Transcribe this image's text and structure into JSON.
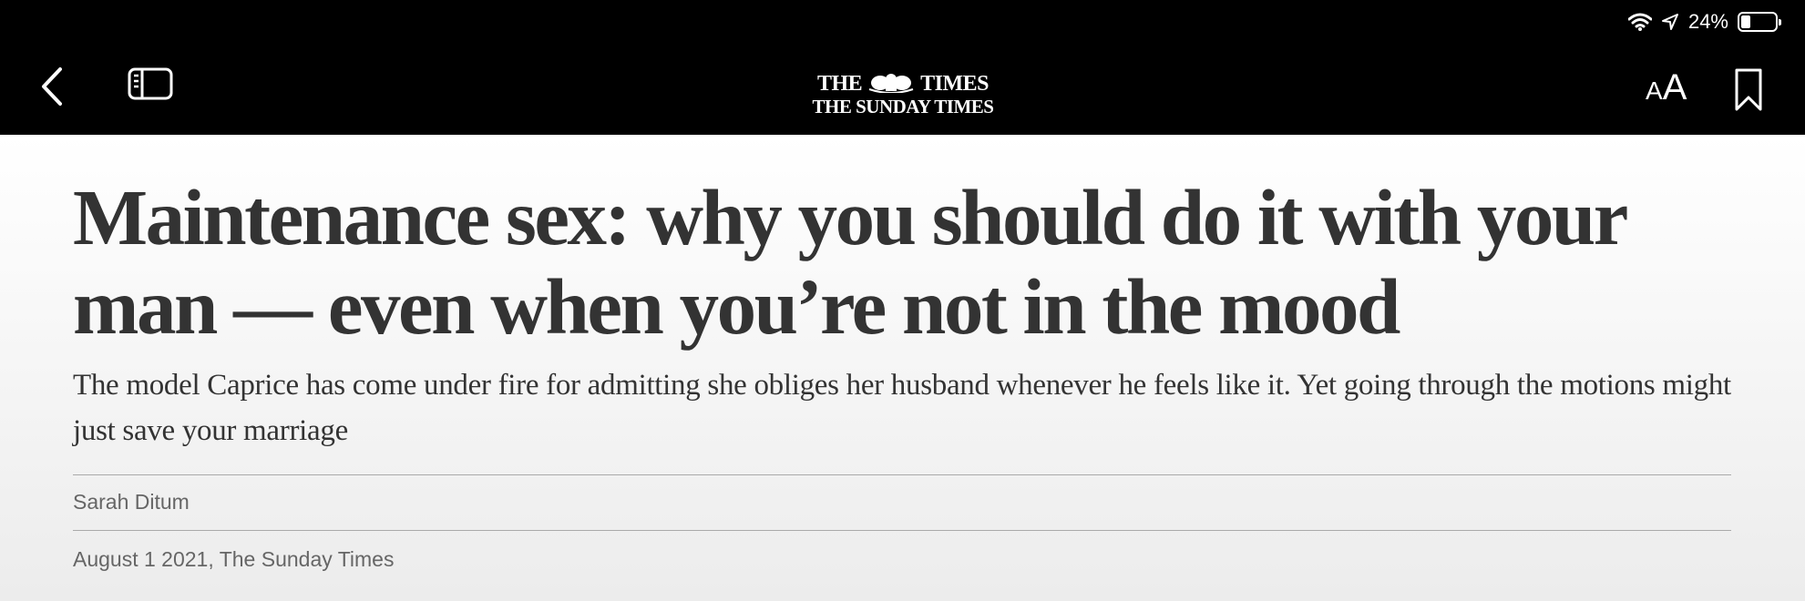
{
  "status_bar": {
    "battery_text": "24%",
    "battery_level": 0.24,
    "icons": [
      "wifi-icon",
      "location-arrow-icon",
      "battery-icon"
    ]
  },
  "navbar": {
    "icons": [
      "chevron-left-icon",
      "sidebar-icon",
      "text-size-icon",
      "bookmark-icon"
    ],
    "text_size_small": "A",
    "text_size_large": "A",
    "logo_line1_left": "THE",
    "logo_line1_right": "TIMES",
    "logo_line2": "THE SUNDAY TIMES"
  },
  "article": {
    "headline": "Maintenance sex: why you should do it with your man — even when you’re not in the mood",
    "standfirst": "The model Caprice has come under fire for admitting she obliges her husband whenever he feels like it. Yet going through the motions might just save your marriage",
    "author": "Sarah Ditum",
    "dateline": "August 1 2021, The Sunday Times"
  },
  "colors": {
    "topbar": "#000000",
    "headline": "#333333",
    "meta": "#666666"
  }
}
